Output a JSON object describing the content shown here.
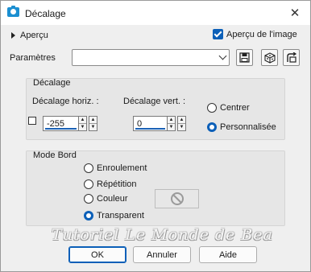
{
  "window": {
    "title": "Décalage",
    "close_glyph": "✕"
  },
  "preview": {
    "label": "Aperçu",
    "apercu_image_label": "Aperçu de l'image",
    "apercu_image_checked": true
  },
  "params": {
    "label": "Paramètres",
    "value": ""
  },
  "decalage": {
    "group_title": "Décalage",
    "horiz_label": "Décalage horiz. :",
    "horiz_value": "-255",
    "vert_label": "Décalage vert. :",
    "vert_value": "0",
    "radio_centrer": "Centrer",
    "radio_perso": "Personnalisée",
    "selected": "Personnalisée"
  },
  "mode_bord": {
    "group_title": "Mode Bord",
    "options": [
      "Enroulement",
      "Répétition",
      "Couleur",
      "Transparent"
    ],
    "selected": "Transparent"
  },
  "watermark": "Tutoriel Le Monde de Bea",
  "buttons": {
    "ok": "OK",
    "annuler": "Annuler",
    "aide": "Aide"
  },
  "colors": {
    "accent": "#0b5fb8",
    "title_icon": "#1b8fd1"
  },
  "icons": [
    "camera-icon",
    "close-icon",
    "save-icon",
    "randomize-icon",
    "reset-icon",
    "no-color-icon"
  ]
}
